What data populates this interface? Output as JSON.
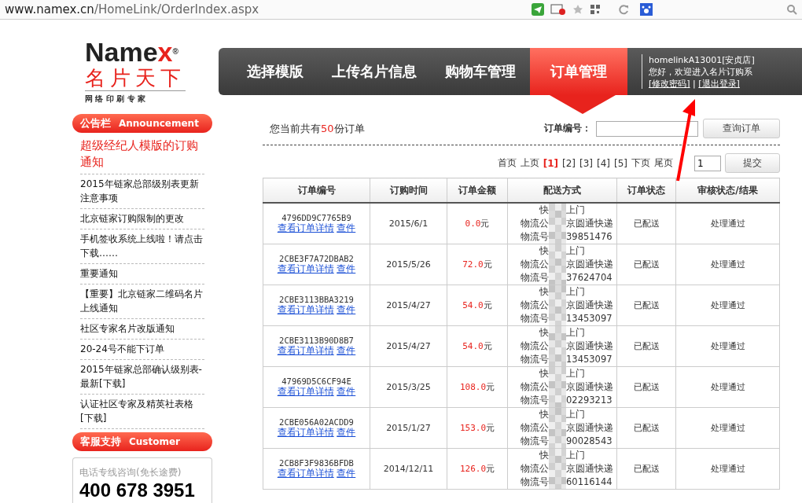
{
  "browser": {
    "url_host": "www.namex.cn",
    "url_path": "/HomeLink/OrderIndex.aspx"
  },
  "logo": {
    "name": "Name",
    "accent": "x",
    "reg": "®",
    "subtitle": "名片天下",
    "tagline": "网 络 印 刷 专 家"
  },
  "nav": {
    "tabs": [
      {
        "label": "选择模版",
        "selected": false
      },
      {
        "label": "上传名片信息",
        "selected": false
      },
      {
        "label": "购物车管理",
        "selected": false
      },
      {
        "label": "订单管理",
        "selected": true
      }
    ],
    "user": {
      "account": "homelinkA13001[安贞店]",
      "welcome": "您好，欢迎进入名片订购系",
      "links": [
        "[修改密码]",
        "[退出登录]"
      ],
      "separator": "|"
    }
  },
  "sidebar": {
    "announcement": {
      "title": "公告栏",
      "title_en": "Announcement",
      "items": [
        {
          "text": "超级经纪人模版的订购通知",
          "highlight": true
        },
        {
          "text": "2015年链家总部级别表更新注意事项",
          "highlight": false
        },
        {
          "text": "北京链家订购限制的更改",
          "highlight": false
        },
        {
          "text": "手机签收系统上线啦！请点击下载……",
          "highlight": false
        },
        {
          "text": "重要通知",
          "highlight": false
        },
        {
          "text": "【重要】北京链家二维码名片上线通知",
          "highlight": false
        },
        {
          "text": "社区专家名片改版通知",
          "highlight": false
        },
        {
          "text": "20-24号不能下订单",
          "highlight": false
        },
        {
          "text": "2015年链家总部确认级别表-最新[下载]",
          "highlight": false
        },
        {
          "text": "认证社区专家及精英社表格[下载]",
          "highlight": false
        }
      ]
    },
    "support": {
      "title": "客服支持",
      "title_en": "Customer",
      "phone_label": "电话专线咨询(免长途费)",
      "phone": "400 678 3951"
    }
  },
  "main": {
    "summary": {
      "prefix": "您当前共有",
      "count": "50",
      "suffix": "份订单"
    },
    "search": {
      "label": "订单编号：",
      "button": "查询订单"
    },
    "pager": {
      "links": [
        {
          "label": "首页",
          "selected": false
        },
        {
          "label": "上页",
          "selected": false
        },
        {
          "label": "[1]",
          "selected": true
        },
        {
          "label": "[2]",
          "selected": false
        },
        {
          "label": "[3]",
          "selected": false
        },
        {
          "label": "[4]",
          "selected": false
        },
        {
          "label": "[5]",
          "selected": false
        },
        {
          "label": "下页",
          "selected": false
        },
        {
          "label": "尾页",
          "selected": false
        }
      ],
      "goto_value": "1",
      "goto_button": "提交"
    },
    "table": {
      "columns": [
        "订单编号",
        "订购时间",
        "订单金额",
        "配送方式",
        "订单状态",
        "审核状态/结果"
      ],
      "rows": [
        {
          "order_no": "4796DD9C7765B9",
          "links": [
            "查看订单详情",
            "查件"
          ],
          "date": "2015/6/1",
          "amount": "0.0",
          "currency": "元",
          "delivery": [
            [
              "快",
              "上门"
            ],
            [
              "物流公",
              "京圆通快递"
            ],
            [
              "物流号",
              "39851476"
            ]
          ],
          "status": "已配送",
          "review": "处理通过"
        },
        {
          "order_no": "2CBE3F7A72DBAB2",
          "links": [
            "查看订单详情",
            "查件"
          ],
          "date": "2015/5/26",
          "amount": "72.0",
          "currency": "元",
          "delivery": [
            [
              "快",
              "上门"
            ],
            [
              "物流公",
              "京圆通快递"
            ],
            [
              "物流号",
              "37624704"
            ]
          ],
          "status": "已配送",
          "review": "处理通过"
        },
        {
          "order_no": "2CBE3113BBA3219",
          "links": [
            "查看订单详情",
            "查件"
          ],
          "date": "2015/4/27",
          "amount": "54.0",
          "currency": "元",
          "delivery": [
            [
              "快",
              "上门"
            ],
            [
              "物流公",
              "京圆通快递"
            ],
            [
              "物流号",
              "13453097"
            ]
          ],
          "status": "已配送",
          "review": "处理通过"
        },
        {
          "order_no": "2CBE3113B90D8B7",
          "links": [
            "查看订单详情",
            "查件"
          ],
          "date": "2015/4/27",
          "amount": "54.0",
          "currency": "元",
          "delivery": [
            [
              "快",
              "上门"
            ],
            [
              "物流公",
              "京圆通快递"
            ],
            [
              "物流号",
              "13453097"
            ]
          ],
          "status": "已配送",
          "review": "处理通过"
        },
        {
          "order_no": "47969D5C6CF94E",
          "links": [
            "查看订单详情",
            "查件"
          ],
          "date": "2015/3/25",
          "amount": "108.0",
          "currency": "元",
          "delivery": [
            [
              "快",
              "上门"
            ],
            [
              "物流公",
              "京圆通快递"
            ],
            [
              "物流号",
              "02293213"
            ]
          ],
          "status": "已配送",
          "review": "处理通过"
        },
        {
          "order_no": "2CBE056A02ACDD9",
          "links": [
            "查看订单详情",
            "查件"
          ],
          "date": "2015/1/27",
          "amount": "153.0",
          "currency": "元",
          "delivery": [
            [
              "快",
              "上门"
            ],
            [
              "物流公",
              "京圆通快递"
            ],
            [
              "物流号",
              "90028543"
            ]
          ],
          "status": "已配送",
          "review": "处理通过"
        },
        {
          "order_no": "2CB8F3F9836BFDB",
          "links": [
            "查看订单详情",
            "查件"
          ],
          "date": "2014/12/11",
          "amount": "126.0",
          "currency": "元",
          "delivery": [
            [
              "快",
              "上门"
            ],
            [
              "物流公",
              "京圆通快递"
            ],
            [
              "物流号",
              "60116144"
            ]
          ],
          "status": "已配送",
          "review": "处理通过"
        }
      ]
    }
  }
}
